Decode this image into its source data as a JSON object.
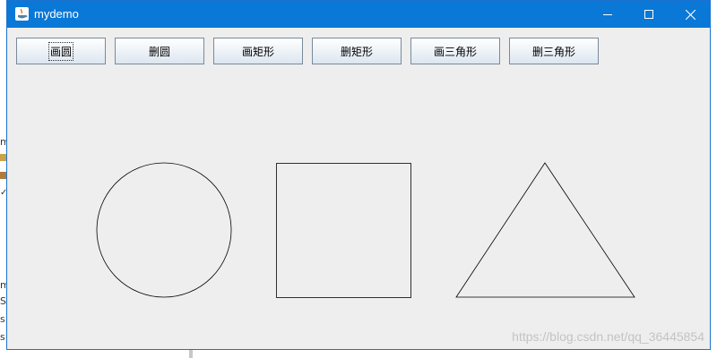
{
  "window": {
    "title": "mydemo",
    "controls": {
      "minimize": "minimize-icon",
      "maximize": "maximize-icon",
      "close": "close-icon"
    }
  },
  "toolbar": {
    "buttons": [
      {
        "label": "画圆",
        "focused": true
      },
      {
        "label": "删圆"
      },
      {
        "label": "画矩形"
      },
      {
        "label": "删矩形"
      },
      {
        "label": "画三角形"
      },
      {
        "label": "删三角形"
      }
    ]
  },
  "shapes": [
    "circle",
    "square",
    "triangle"
  ],
  "background_app": {
    "sidebar_text": [
      "m",
      "m",
      "S",
      "s",
      "s"
    ]
  },
  "watermark": "https://blog.csdn.net/qq_36445854",
  "colors": {
    "titlebar": "#0a78d7",
    "window_bg": "#eeeeee",
    "shape_stroke": "#000000"
  }
}
